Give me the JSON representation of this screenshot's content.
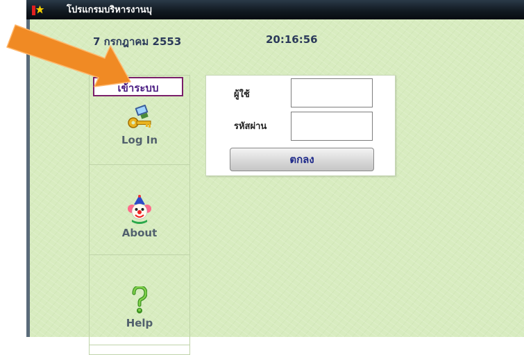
{
  "window": {
    "title": "โปรแกรมบริหารงานบุ"
  },
  "header": {
    "date": "7 กรกฎาคม 2553",
    "time": "20:16:56"
  },
  "sidebar": {
    "active_tab": "เข้าระบบ",
    "items": [
      {
        "label": "Log In",
        "icon": "key-computer-icon"
      },
      {
        "label": "About",
        "icon": "clown-icon"
      },
      {
        "label": "Help",
        "icon": "question-mark-icon"
      }
    ]
  },
  "login": {
    "user_label": "ผู้ใช้",
    "password_label": "รหัสผ่าน",
    "user_value": "",
    "password_value": "",
    "ok_label": "ตกลง"
  },
  "colors": {
    "background": "#d8ecc0",
    "arrow": "#f08a24",
    "tab_border": "#7a1f6a",
    "button_text": "#1f2a8a"
  }
}
